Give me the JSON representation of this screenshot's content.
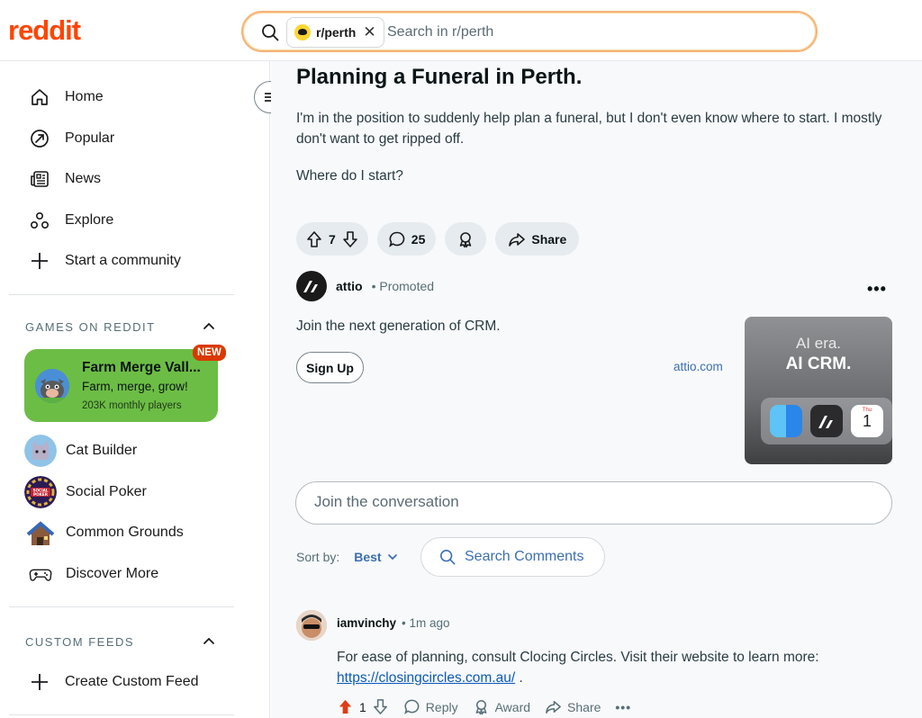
{
  "header": {
    "logo": "reddit",
    "subreddit_chip": "r/perth",
    "search_placeholder": "Search in r/perth"
  },
  "sidebar": {
    "nav": [
      {
        "label": "Home",
        "icon": "home-icon"
      },
      {
        "label": "Popular",
        "icon": "popular-icon"
      },
      {
        "label": "News",
        "icon": "news-icon"
      },
      {
        "label": "Explore",
        "icon": "explore-icon"
      },
      {
        "label": "Start a community",
        "icon": "plus-icon"
      }
    ],
    "games_heading": "GAMES ON REDDIT",
    "featured_game": {
      "title": "Farm Merge Vall...",
      "tagline": "Farm, merge, grow!",
      "players": "203K monthly players",
      "badge": "NEW"
    },
    "games": [
      {
        "label": "Cat Builder",
        "icon": "cat-builder-icon"
      },
      {
        "label": "Social Poker",
        "icon": "social-poker-icon"
      },
      {
        "label": "Common Grounds",
        "icon": "common-grounds-icon"
      },
      {
        "label": "Discover More",
        "icon": "gamepad-icon"
      }
    ],
    "feeds_heading": "CUSTOM FEEDS",
    "create_feed": "Create Custom Feed"
  },
  "post": {
    "title": "Planning a Funeral in Perth.",
    "body": [
      "I'm in the position to suddenly help plan a funeral, but I don't even know where to start. I mostly don't want to get ripped off.",
      "Where do I start?"
    ],
    "votes": "7",
    "comments": "25",
    "share_label": "Share"
  },
  "ad": {
    "advertiser": "attio",
    "promoted": "Promoted",
    "text": "Join the next generation of CRM.",
    "cta": "Sign Up",
    "link": "attio.com",
    "image_line1": "AI era.",
    "image_line2": "AI CRM.",
    "calendar_day_label": "Thu",
    "calendar_day": "1"
  },
  "comments_section": {
    "placeholder": "Join the conversation",
    "sort_label": "Sort by:",
    "sort_value": "Best",
    "search_label": "Search Comments"
  },
  "comment": {
    "user": "iamvinchy",
    "time": "1m ago",
    "text": "For ease of planning, consult Clocing Circles. Visit their website to learn more:",
    "link": "https://closingcircles.com.au/",
    "link_suffix": " .",
    "votes": "1",
    "reply": "Reply",
    "award": "Award",
    "share": "Share"
  },
  "colors": {
    "brand": "#ff4500",
    "game_card": "#6cbd45",
    "link": "#3b6fb0"
  }
}
